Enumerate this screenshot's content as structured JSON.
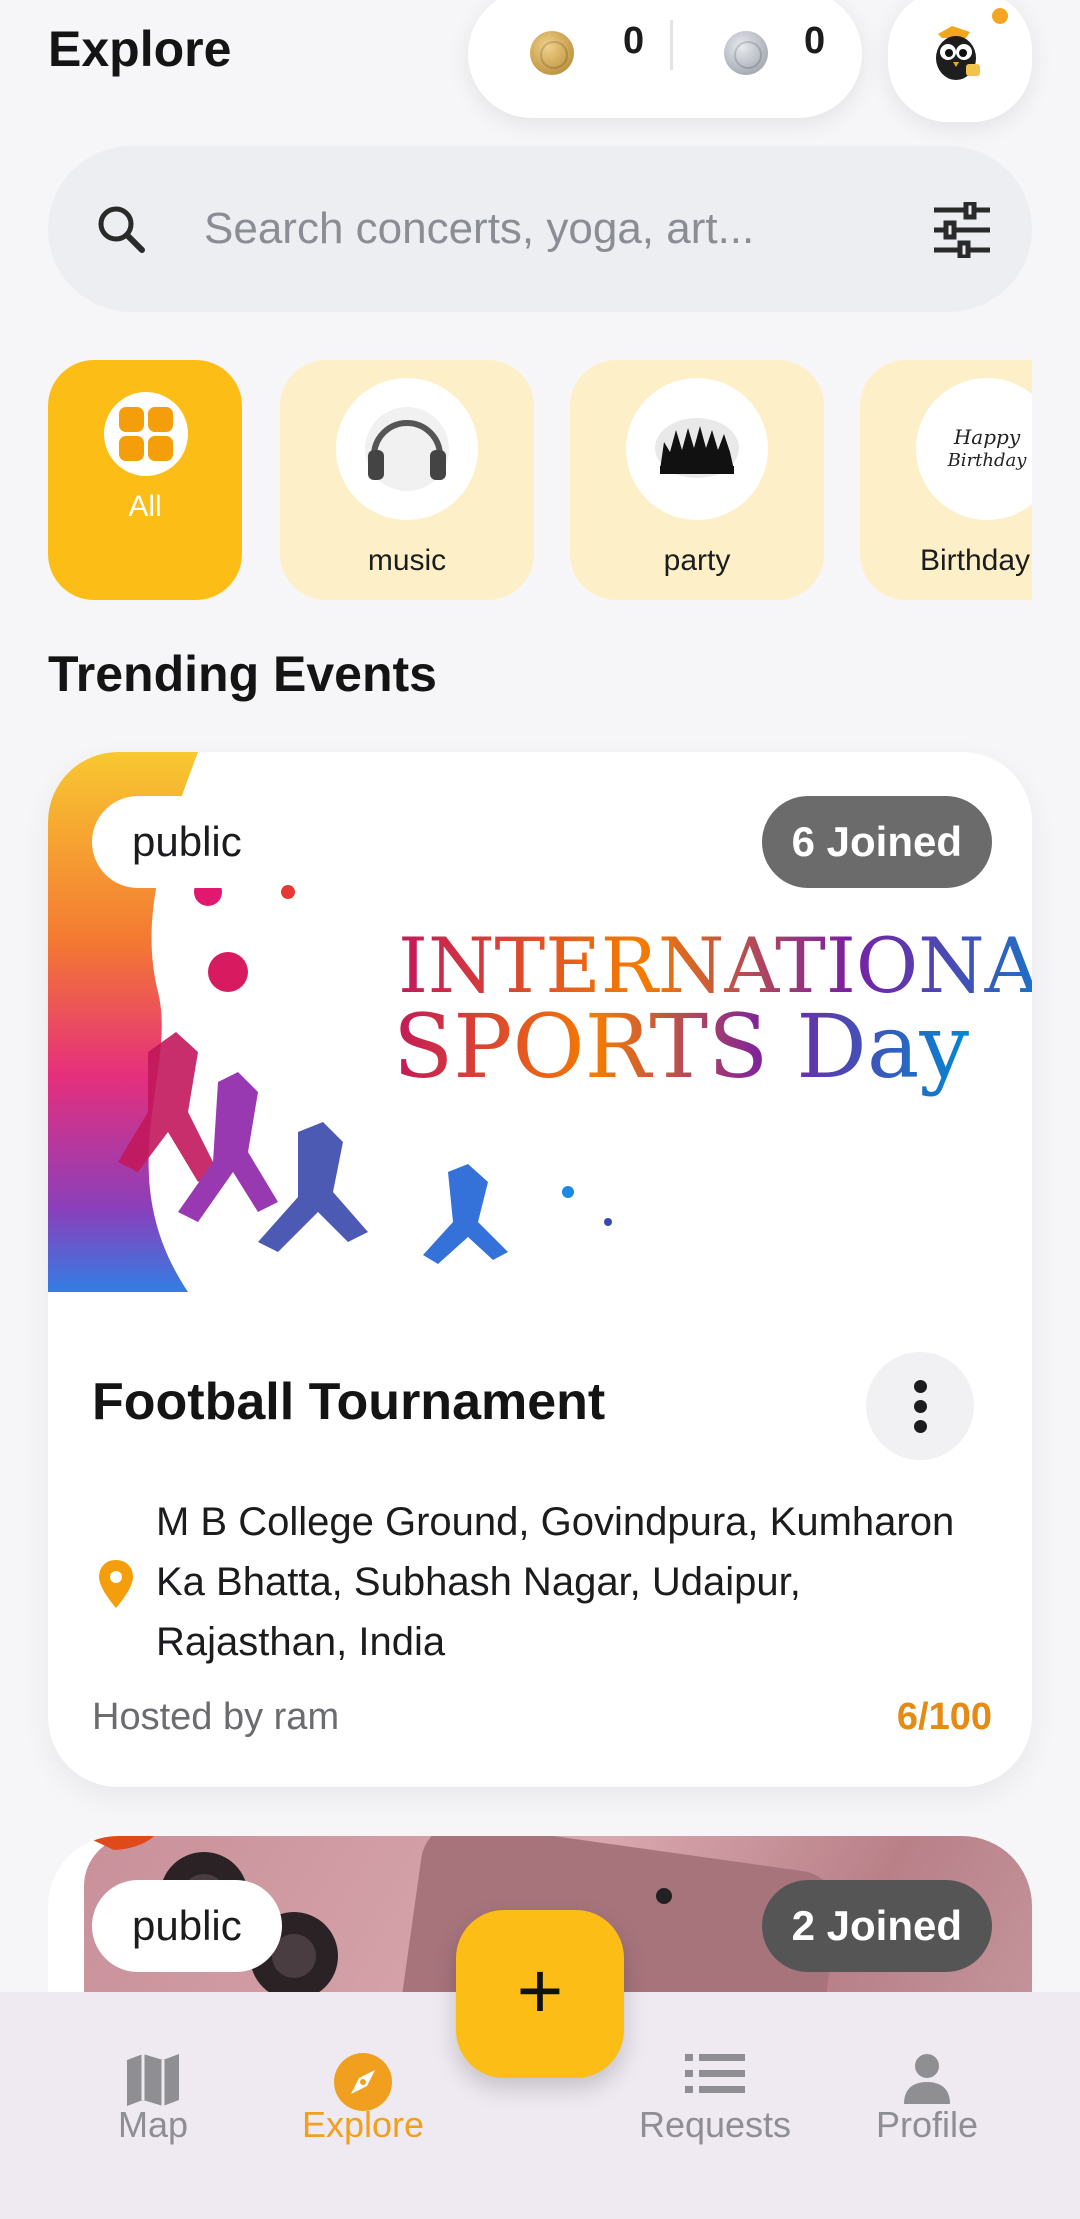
{
  "header": {
    "title": "Explore",
    "gold_coins": "0",
    "silver_coins": "0"
  },
  "search": {
    "placeholder": "Search concerts, yoga, art..."
  },
  "categories": [
    {
      "label": "All",
      "icon": "grid-icon"
    },
    {
      "label": "music",
      "icon": "headphones-icon"
    },
    {
      "label": "party",
      "icon": "party-crowd-icon"
    },
    {
      "label": "Birthday",
      "icon": "birthday-icon"
    }
  ],
  "section": {
    "title": "Trending Events"
  },
  "events": [
    {
      "visibility": "public",
      "joined": "6 Joined",
      "banner_text_line1": "INTERNATIONAL",
      "banner_text_line2": "SPORTS Day",
      "title": "Football Tournament",
      "address": "M B College Ground, Govindpura, Kumharon Ka Bhatta, Subhash Nagar, Udaipur, Rajasthan, India",
      "host": "Hosted by ram",
      "capacity": "6/100"
    },
    {
      "visibility": "public",
      "joined": "2 Joined"
    }
  ],
  "fab": {
    "label": "+"
  },
  "nav": [
    {
      "label": "Map",
      "icon": "map-icon"
    },
    {
      "label": "Explore",
      "icon": "compass-icon"
    },
    {
      "label": "Requests",
      "icon": "list-icon"
    },
    {
      "label": "Profile",
      "icon": "person-icon"
    }
  ],
  "colors": {
    "accent": "#fbbd16",
    "accent_text": "#f0a01e",
    "category_bg": "#fdf0c8",
    "joined_badge": "#6b6b6b"
  }
}
